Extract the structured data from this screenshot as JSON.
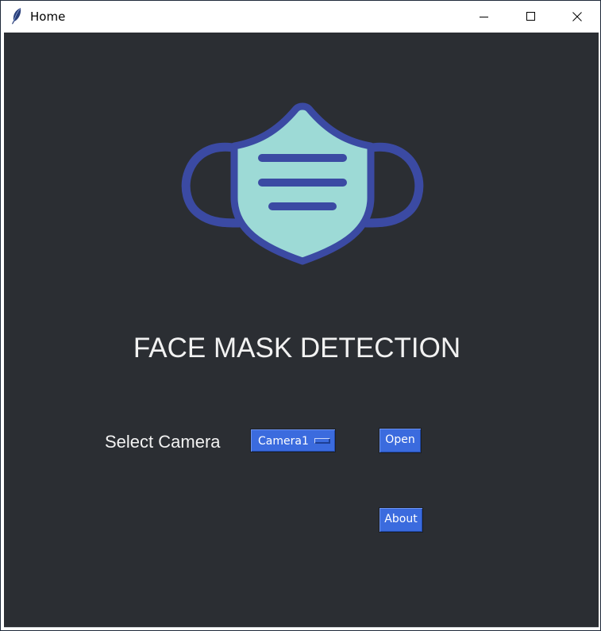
{
  "window": {
    "title": "Home"
  },
  "icons": {
    "app": "feather-icon",
    "minimize": "minimize-icon",
    "maximize": "maximize-icon",
    "close": "close-icon",
    "logo": "face-mask-icon"
  },
  "colors": {
    "background": "#2b2e33",
    "accent": "#3b6bde",
    "mask_fill": "#9ddad6",
    "mask_stroke": "#3b4aa3",
    "text": "#f2f2f2"
  },
  "main": {
    "heading": "FACE MASK DETECTION",
    "camera_label": "Select Camera",
    "camera_select": {
      "value": "Camera1"
    },
    "open_button": "Open",
    "about_button": "About"
  }
}
